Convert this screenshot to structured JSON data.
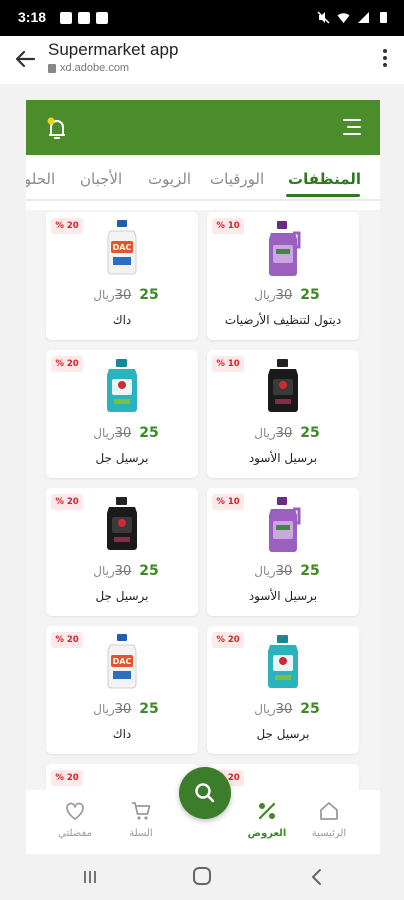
{
  "status_bar": {
    "time": "3:18"
  },
  "browser": {
    "title": "Supermarket app",
    "url": "xd.adobe.com"
  },
  "colors": {
    "brand_green": "#4b8d2a",
    "price_green": "#3d8a23",
    "badge_red": "#d6202a"
  },
  "tabs": [
    {
      "label": "المنظفات",
      "active": true
    },
    {
      "label": "الورقيات",
      "active": false
    },
    {
      "label": "الزيوت",
      "active": false
    },
    {
      "label": "الأجبان",
      "active": false
    },
    {
      "label": "الحلو",
      "active": false
    }
  ],
  "currency": "ريال",
  "products": [
    {
      "name": "ديتول لتنظيف الأرضيات",
      "badge": "% 10",
      "old_price": "30",
      "new_price": "25",
      "image": "purple-dettol-bottle"
    },
    {
      "name": "داك",
      "badge": "% 20",
      "old_price": "30",
      "new_price": "25",
      "image": "dac-bottle"
    },
    {
      "name": "برسيل الأسود",
      "badge": "% 10",
      "old_price": "30",
      "new_price": "25",
      "image": "black-persil-bottle"
    },
    {
      "name": "برسيل جل",
      "badge": "% 20",
      "old_price": "30",
      "new_price": "25",
      "image": "teal-persil-bottle"
    },
    {
      "name": "برسيل الأسود",
      "badge": "% 10",
      "old_price": "30",
      "new_price": "25",
      "image": "purple-dettol-bottle"
    },
    {
      "name": "برسيل جل",
      "badge": "% 20",
      "old_price": "30",
      "new_price": "25",
      "image": "black-persil-bottle"
    },
    {
      "name": "برسيل جل",
      "badge": "% 20",
      "old_price": "30",
      "new_price": "25",
      "image": "teal-persil-bottle"
    },
    {
      "name": "داك",
      "badge": "% 20",
      "old_price": "30",
      "new_price": "25",
      "image": "dac-bottle"
    },
    {
      "name": "",
      "badge": "% 20",
      "old_price": "",
      "new_price": "",
      "image": ""
    },
    {
      "name": "",
      "badge": "% 20",
      "old_price": "",
      "new_price": "",
      "image": ""
    }
  ],
  "bottom_nav": [
    {
      "label": "الرئيسية",
      "icon": "home-icon",
      "active": false
    },
    {
      "label": "العروض",
      "icon": "percent-icon",
      "active": true
    },
    {
      "label": "السلة",
      "icon": "cart-icon",
      "active": false
    },
    {
      "label": "مفضلتي",
      "icon": "heart-icon",
      "active": false
    }
  ]
}
